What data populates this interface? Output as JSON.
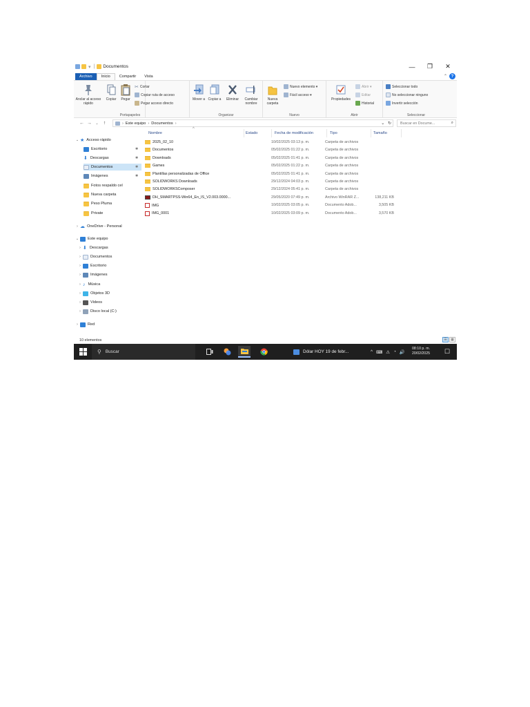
{
  "window": {
    "title": "Documentos",
    "minimize": "—",
    "maximize": "❐",
    "close": "✕",
    "qa_sep": "|",
    "qa_arrow": "▾"
  },
  "tabs": {
    "file": "Archivo",
    "home": "Inicio",
    "share": "Compartir",
    "view": "Vista",
    "collapse": "⌃",
    "help": "?"
  },
  "ribbon": {
    "clipboard": {
      "pin_label": "Anclar al acceso rápido",
      "copy_label": "Copiar",
      "paste_label": "Pegar",
      "cut_label": "Cortar",
      "copy_path_label": "Copiar ruta de acceso",
      "paste_shortcut_label": "Pegar acceso directo",
      "group_label": "Portapapeles"
    },
    "organize": {
      "move_label": "Mover a",
      "copy_to_label": "Copiar a",
      "delete_label": "Eliminar",
      "rename_label": "Cambiar nombre",
      "group_label": "Organizar"
    },
    "new": {
      "new_folder_label": "Nueva carpeta",
      "new_item_label": "Nuevo elemento ▾",
      "easy_access_label": "Fácil acceso ▾",
      "group_label": "Nuevo"
    },
    "open": {
      "properties_label": "Propiedades",
      "open_label": "Abrir ▾",
      "edit_label": "Editar",
      "history_label": "Historial",
      "group_label": "Abrir"
    },
    "select": {
      "select_all_label": "Seleccionar todo",
      "select_none_label": "No seleccionar ninguno",
      "invert_label": "Invertir selección",
      "group_label": "Seleccionar"
    }
  },
  "address": {
    "back": "←",
    "forward": "→",
    "recent": "⌄",
    "up": "↑",
    "sep": "›",
    "crumbs": [
      "Este equipo",
      "Documentos"
    ],
    "dropdown": "⌄",
    "refresh": "↻",
    "search_placeholder": "Buscar en Docume...",
    "search_icon": "⌕"
  },
  "nav": {
    "chev_open": "⌄",
    "chev_closed": "›",
    "pin": "✱",
    "quick_access": "Acceso rápido",
    "quick_items": [
      "Escritorio",
      "Descargas",
      "Documentos",
      "Imágenes",
      "Fotos respaldo cel",
      "Nueva carpeta",
      "Peso Pluma",
      "Private"
    ],
    "onedrive": "OneDrive - Personal",
    "this_pc": "Este equipo",
    "pc_items": [
      "Descargas",
      "Documentos",
      "Escritorio",
      "Imágenes",
      "Música",
      "Objetos 3D",
      "Videos",
      "Disco local (C:)"
    ],
    "network": "Red"
  },
  "columns": {
    "name": "Nombre",
    "status": "Estado",
    "date": "Fecha de modificación",
    "type": "Tipo",
    "size": "Tamaño",
    "sort_indicator": "^"
  },
  "files": [
    {
      "name": "2025_02_10",
      "date": "10/02/2025 03:13 p. m.",
      "type": "Carpeta de archivos",
      "size": "",
      "kind": "folder"
    },
    {
      "name": "Documentos",
      "date": "05/02/2025 01:22 p. m.",
      "type": "Carpeta de archivos",
      "size": "",
      "kind": "folder"
    },
    {
      "name": "Downloads",
      "date": "05/02/2025 01:41 p. m.",
      "type": "Carpeta de archivos",
      "size": "",
      "kind": "folder"
    },
    {
      "name": "Games",
      "date": "05/02/2025 01:22 p. m.",
      "type": "Carpeta de archivos",
      "size": "",
      "kind": "folder"
    },
    {
      "name": "Plantillas personalizadas de Office",
      "date": "05/02/2025 01:41 p. m.",
      "type": "Carpeta de archivos",
      "size": "",
      "kind": "folder"
    },
    {
      "name": "SOLIDWORKS Downloads",
      "date": "29/12/2024 04:03 p. m.",
      "type": "Carpeta de archivos",
      "size": "",
      "kind": "folder"
    },
    {
      "name": "SOLIDWORKSComposer",
      "date": "29/12/2024 05:41 p. m.",
      "type": "Carpeta de archivos",
      "size": "",
      "kind": "folder"
    },
    {
      "name": "DH_SMARTPSS-Win64_En_IS_V2.003.0000...",
      "date": "29/05/2020 07:49 p. m.",
      "type": "Archivo WinRAR Z...",
      "size": "138,211 KB",
      "kind": "rar"
    },
    {
      "name": "IMG",
      "date": "10/02/2025 03:05 p. m.",
      "type": "Documento Adob...",
      "size": "3,505 KB",
      "kind": "pdf"
    },
    {
      "name": "IMG_0001",
      "date": "10/02/2025 03:09 p. m.",
      "type": "Documento Adob...",
      "size": "3,570 KB",
      "kind": "pdf"
    }
  ],
  "status": {
    "count": "10 elementos",
    "details_view": "☰",
    "icons_view": "▦"
  },
  "taskbar": {
    "search_icon": "⚲",
    "search_label": "Buscar",
    "window_label": "Dólar HOY 19 de febr...",
    "tray_chevron": "^",
    "tray_icons": [
      "⌨",
      "⚠",
      "◔",
      "🔊"
    ],
    "time": "08:10 p. m.",
    "date": "20/02/2025",
    "notifications": "☐"
  },
  "colors": {
    "accent": "#1a5fb4",
    "selection": "#cce4f7",
    "folder": "#f6c443",
    "taskbar": "#1f1f1f"
  }
}
